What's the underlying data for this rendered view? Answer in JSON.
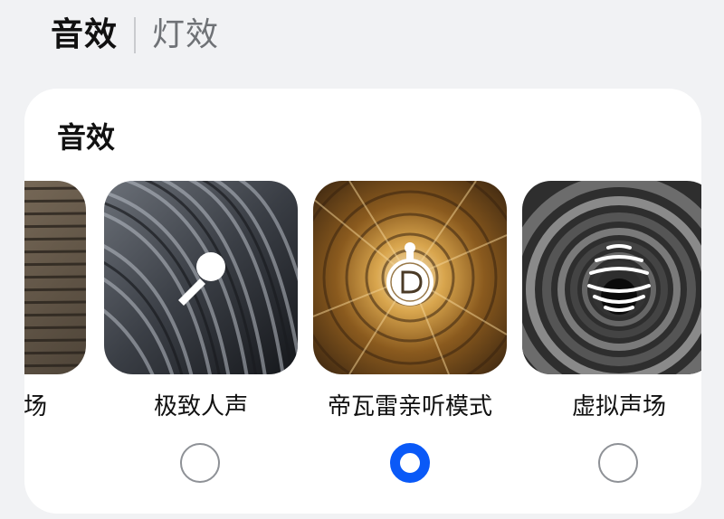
{
  "tabs": [
    {
      "label": "音效",
      "active": true
    },
    {
      "label": "灯效",
      "active": false
    }
  ],
  "card": {
    "title": "音效",
    "options": [
      {
        "label": "场",
        "selected": false,
        "icon": "partial-prev-icon"
      },
      {
        "label": "极致人声",
        "selected": false,
        "icon": "microphone-icon"
      },
      {
        "label": "帝瓦雷亲听模式",
        "selected": true,
        "icon": "devialet-logo-icon"
      },
      {
        "label": "虚拟声场",
        "selected": false,
        "icon": "sound-field-rings-icon"
      }
    ]
  },
  "colors": {
    "accent": "#0a59f7",
    "background": "#f1f2f4",
    "card": "#ffffff"
  }
}
